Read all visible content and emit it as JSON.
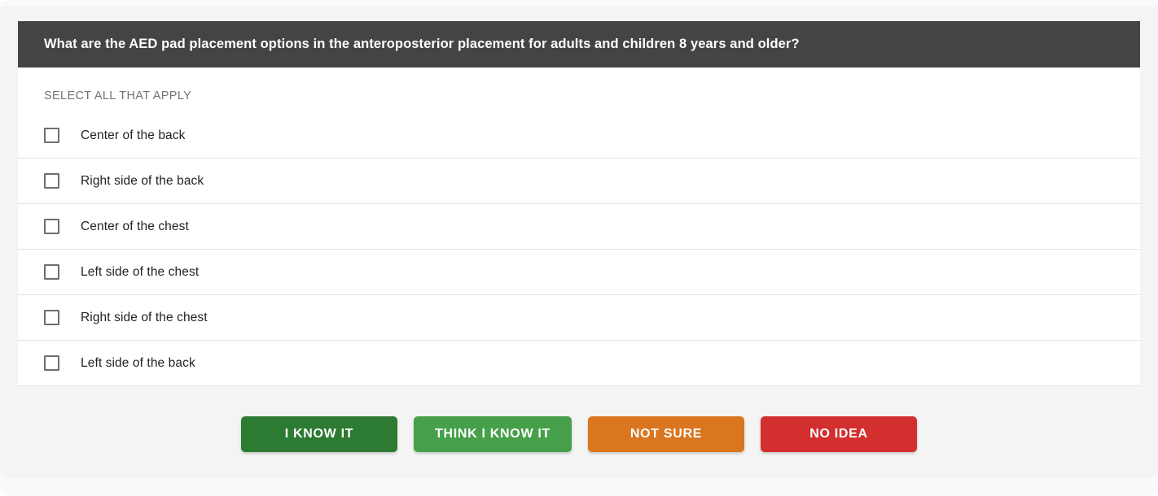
{
  "theme": {
    "page_background": "#f4f4f4",
    "shell_background": "#fafafa",
    "header_background": "#444444",
    "card_background": "#ffffff",
    "divider_color": "#e4e4e4",
    "option_text_color": "#222222",
    "instruction_text_color": "#737373"
  },
  "quiz": {
    "question": "What are the AED pad placement options in the anteroposterior placement for adults and children 8 years and older?",
    "instruction": "SELECT ALL THAT APPLY",
    "options": [
      {
        "label": "Center of the back",
        "checked": false
      },
      {
        "label": "Right side of the back",
        "checked": false
      },
      {
        "label": "Center of the chest",
        "checked": false
      },
      {
        "label": "Left side of the chest",
        "checked": false
      },
      {
        "label": "Right side of the chest",
        "checked": false
      },
      {
        "label": "Left side of the back",
        "checked": false
      }
    ]
  },
  "footer": {
    "buttons": [
      {
        "label": "I KNOW IT",
        "color": "#2d7a32"
      },
      {
        "label": "THINK I KNOW IT",
        "color": "#46a04a"
      },
      {
        "label": "NOT SURE",
        "color": "#d9761f"
      },
      {
        "label": "NO IDEA",
        "color": "#d32f2f"
      }
    ]
  }
}
